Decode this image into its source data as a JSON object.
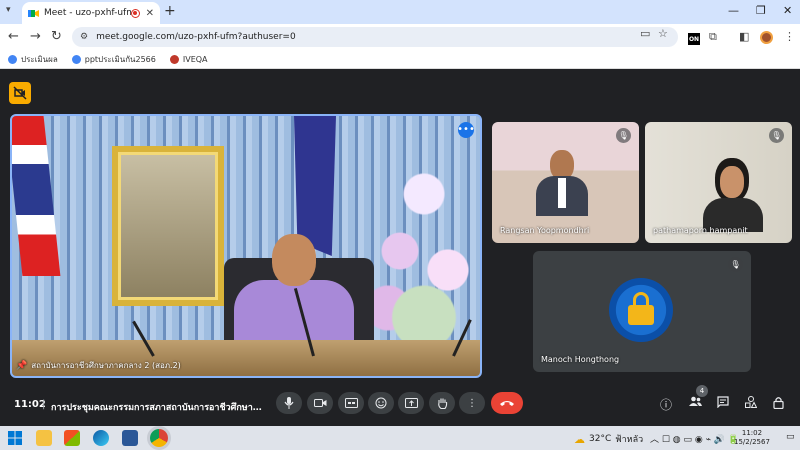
{
  "browser": {
    "tab_title": "Meet - uzo-pxhf-ufm",
    "tab_close": "✕",
    "new_tab": "+",
    "url": "meet.google.com/uzo-pxhf-ufm?authuser=0",
    "bookmarks": [
      {
        "label": "ประเมินผล",
        "color": "#4285f4"
      },
      {
        "label": "pptประเมินกัน2566",
        "color": "#4285f4"
      },
      {
        "label": "IVEQA",
        "color": "#c0392b"
      }
    ],
    "ext_badge": "ON"
  },
  "meet": {
    "main_tile": {
      "label": "สถาบันการอาชีวศึกษาภาคกลาง 2 (สอภ.2)",
      "more": "•••"
    },
    "participants": [
      {
        "name": "Rangsan Yoopmondhri"
      },
      {
        "name": "pathamaporn hampanit"
      },
      {
        "name": "Manoch Hongthong"
      }
    ],
    "controls": {
      "time": "11:02",
      "separator": "|",
      "meeting_title": "การประชุมคณะกรรมการสภาสถาบันการอาชีวศึกษาภาคกลาง",
      "people_count": "4"
    }
  },
  "taskbar": {
    "temperature": "32°C",
    "weather_text": "ฟ้าหลัว",
    "clock_time": "11:02",
    "clock_date": "15/2/2567"
  },
  "colors": {
    "accent": "#8ab4f8",
    "hangup": "#ea4335",
    "host_badge": "#f9ab00"
  }
}
